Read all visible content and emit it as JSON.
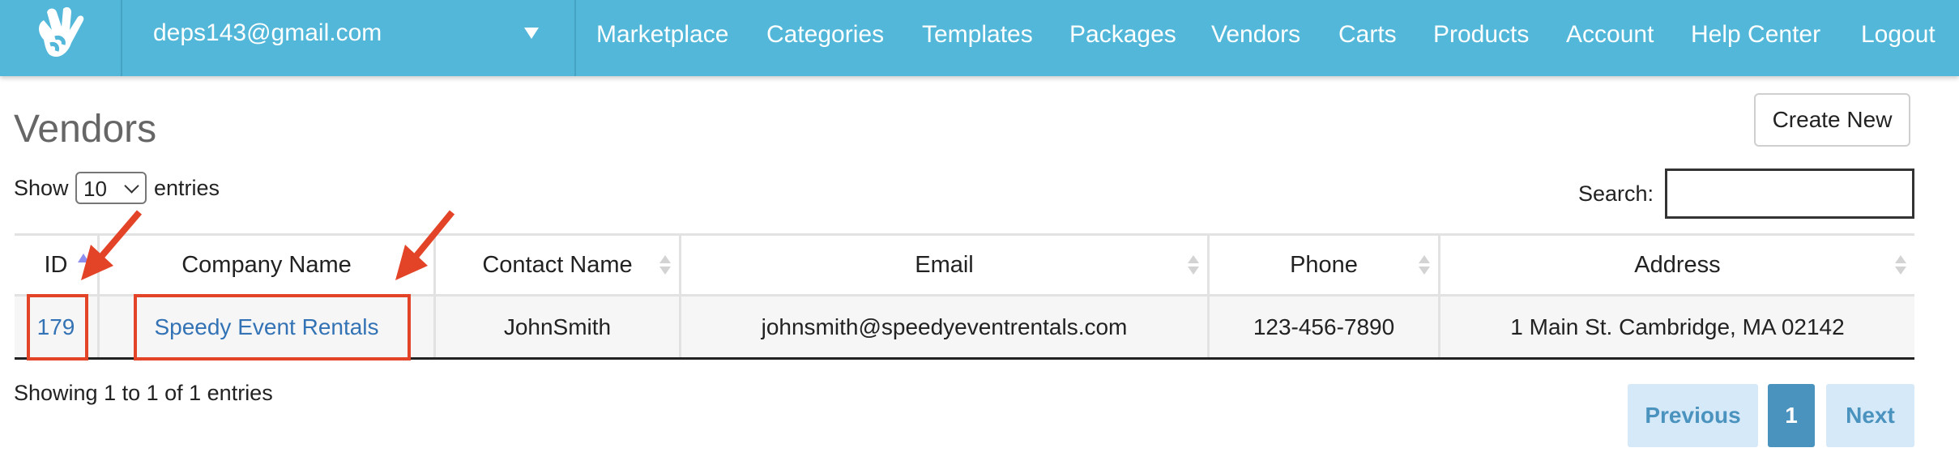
{
  "header": {
    "account_email": "deps143@gmail.com",
    "nav": [
      "Marketplace",
      "Categories",
      "Templates",
      "Packages",
      "Vendors",
      "Carts",
      "Products",
      "Account",
      "Help Center",
      "Logout"
    ]
  },
  "page": {
    "title": "Vendors",
    "create_label": "Create New",
    "show_label": "Show",
    "page_size": "10",
    "entries_label": "entries",
    "search_label": "Search:",
    "search_value": ""
  },
  "table": {
    "columns": [
      "ID",
      "Company Name",
      "Contact Name",
      "Email",
      "Phone",
      "Address"
    ],
    "rows": [
      {
        "id": "179",
        "company": "Speedy Event Rentals",
        "contact": "JohnSmith",
        "email": "johnsmith@speedyeventrentals.com",
        "phone": "123-456-7890",
        "address": "1 Main St. Cambridge, MA 02142"
      }
    ]
  },
  "footer": {
    "info": "Showing 1 to 1 of 1 entries",
    "previous": "Previous",
    "current_page": "1",
    "next": "Next"
  },
  "colors": {
    "nav_bg": "#52b7d9",
    "link": "#3373b5",
    "annotation": "#e34428",
    "page_active": "#4a93bf",
    "page_disabled": "#d6e9f8"
  }
}
